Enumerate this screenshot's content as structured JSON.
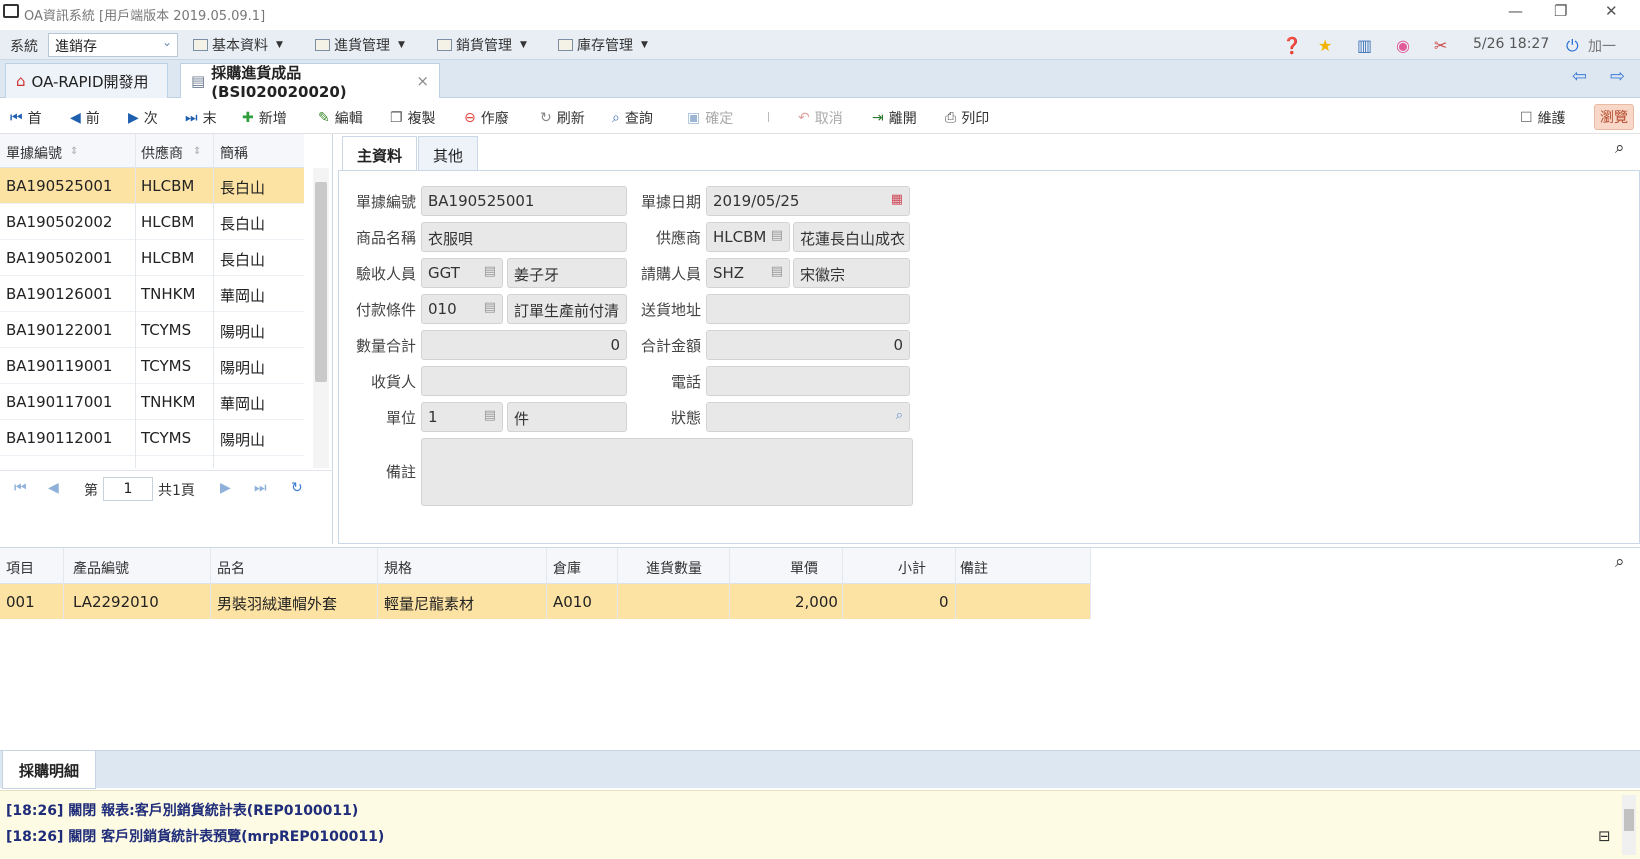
{
  "window": {
    "title": "OA資訊系統 [用戶端版本 2019.05.09.1]",
    "controls": {
      "minimize": "—",
      "restore": "❐",
      "close": "✕"
    }
  },
  "menubar": {
    "system_label": "系統",
    "system_value": "進銷存",
    "menus": [
      "基本資料",
      "進貨管理",
      "銷貨管理",
      "庫存管理"
    ],
    "datetime": "5/26 18:27",
    "user": "加一"
  },
  "tabs": [
    {
      "label": "OA-RAPID開發用"
    },
    {
      "label": "採購進貨成品(BSI020020020)",
      "close": "×"
    }
  ],
  "toolbar": {
    "first": "首",
    "prev": "前",
    "next": "次",
    "last": "末",
    "add": "新增",
    "edit": "編輯",
    "copy": "複製",
    "void": "作廢",
    "refresh": "刷新",
    "query": "查詢",
    "confirm": "確定",
    "cancel": "取消",
    "leave": "離開",
    "print": "列印",
    "maintain": "維護",
    "browse": "瀏覽"
  },
  "list": {
    "headers": [
      "單據編號",
      "供應商",
      "簡稱"
    ],
    "rows": [
      {
        "no": "BA190525001",
        "vendor": "HLCBM",
        "short": "長白山"
      },
      {
        "no": "BA190502002",
        "vendor": "HLCBM",
        "short": "長白山"
      },
      {
        "no": "BA190502001",
        "vendor": "HLCBM",
        "short": "長白山"
      },
      {
        "no": "BA190126001",
        "vendor": "TNHKM",
        "short": "華岡山"
      },
      {
        "no": "BA190122001",
        "vendor": "TCYMS",
        "short": "陽明山"
      },
      {
        "no": "BA190119001",
        "vendor": "TCYMS",
        "short": "陽明山"
      },
      {
        "no": "BA190117001",
        "vendor": "TNHKM",
        "short": "華岡山"
      },
      {
        "no": "BA190112001",
        "vendor": "TCYMS",
        "short": "陽明山"
      }
    ],
    "pager": {
      "page_prefix": "第",
      "page": "1",
      "total": "共1頁"
    }
  },
  "form": {
    "tabs": [
      "主資料",
      "其他"
    ],
    "labels": {
      "doc_no": "單據編號",
      "doc_date": "單據日期",
      "product": "商品名稱",
      "vendor": "供應商",
      "receiver_staff": "驗收人員",
      "requester": "請購人員",
      "payment": "付款條件",
      "ship_addr": "送貨地址",
      "qty_total": "數量合計",
      "amount_total": "合計金額",
      "consignee": "收貨人",
      "phone": "電話",
      "unit": "單位",
      "status": "狀態",
      "remark": "備註"
    },
    "values": {
      "doc_no": "BA190525001",
      "doc_date": "2019/05/25",
      "product": "衣服唄",
      "vendor_code": "HLCBM",
      "vendor_name": "花蓮長白山成衣",
      "receiver_code": "GGT",
      "receiver_name": "姜子牙",
      "requester_code": "SHZ",
      "requester_name": "宋徽宗",
      "payment_code": "010",
      "payment_name": "訂單生產前付清",
      "ship_addr": "",
      "qty_total": "0",
      "amount_total": "0",
      "consignee": "",
      "phone": "",
      "unit_code": "1",
      "unit_name": "件",
      "status": "",
      "remark": ""
    }
  },
  "detail": {
    "headers": [
      "項目",
      "產品編號",
      "品名",
      "規格",
      "倉庫",
      "進貨數量",
      "單價",
      "小計",
      "備註"
    ],
    "rows": [
      {
        "item": "001",
        "code": "LA2292010",
        "name": "男裝羽絨連帽外套",
        "spec": "輕量尼龍素材",
        "warehouse": "A010",
        "qty": "",
        "price": "2,000",
        "subtotal": "0",
        "remark": ""
      }
    ],
    "tab_label": "採購明細"
  },
  "log": {
    "lines": [
      "[18:26] 關閉 報表:客戶別銷貨統計表(REP0100011)",
      "[18:26] 關閉 客戶別銷貨統計表預覽(mrpREP0100011)"
    ]
  },
  "colors": {
    "selected_row": "#fde3a3",
    "menubar_bg": "#e9eef4",
    "log_bg": "#fdfbe3",
    "log_text": "#1f2c7a"
  }
}
